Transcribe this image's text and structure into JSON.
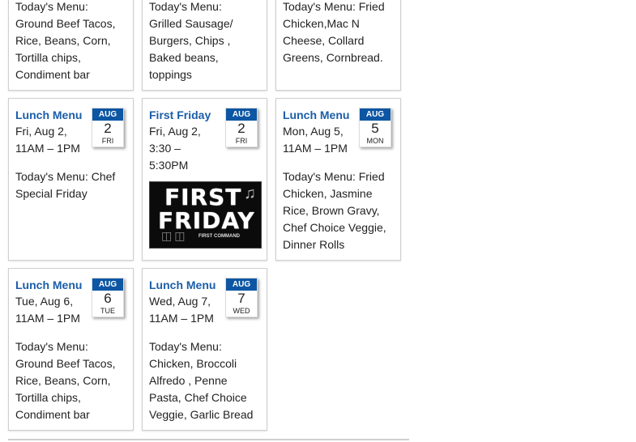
{
  "top_row": [
    {
      "text": "Today's Menu: Ground Beef Tacos, Rice, Beans, Corn, Tortilla chips, Condiment bar"
    },
    {
      "text": "Today's Menu: Grilled Sausage/ Burgers, Chips , Baked beans, toppings"
    },
    {
      "text": "Today's Menu: Fried Chicken,Mac N Cheese, Collard Greens, Cornbread."
    }
  ],
  "events": [
    {
      "title": "Lunch Menu",
      "when": "Fri, Aug 2, 11AM – 1PM",
      "month": "AUG",
      "day": "2",
      "dow": "FRI",
      "text": "Today's Menu: Chef Special Friday"
    },
    {
      "title": "First Friday",
      "when": "Fri, Aug 2, 3:30 – 5:30PM",
      "month": "AUG",
      "day": "2",
      "dow": "FRI",
      "image_label": "FIRST FRIDAY",
      "image_line1": "FIRST",
      "image_line2": "FRIDAY",
      "image_small": "FIRST COMMAND"
    },
    {
      "title": "Lunch Menu",
      "when": "Mon, Aug 5, 11AM – 1PM",
      "month": "AUG",
      "day": "5",
      "dow": "MON",
      "text": "Today's Menu: Fried Chicken, Jasmine Rice, Brown Gravy, Chef Choice Veggie, Dinner Rolls"
    },
    {
      "title": "Lunch Menu",
      "when": "Tue, Aug 6, 11AM – 1PM",
      "month": "AUG",
      "day": "6",
      "dow": "TUE",
      "text": "Today's Menu: Ground Beef Tacos, Rice, Beans, Corn, Tortilla chips, Condiment bar"
    },
    {
      "title": "Lunch Menu",
      "when": "Wed, Aug 7, 11AM – 1PM",
      "month": "AUG",
      "day": "7",
      "dow": "WED",
      "text": "Today's Menu: Chicken, Broccoli Alfredo , Penne Pasta, Chef Choice Veggie, Garlic Bread"
    }
  ],
  "colors": {
    "accent": "#0c56a3",
    "title": "#1a5ea8"
  }
}
